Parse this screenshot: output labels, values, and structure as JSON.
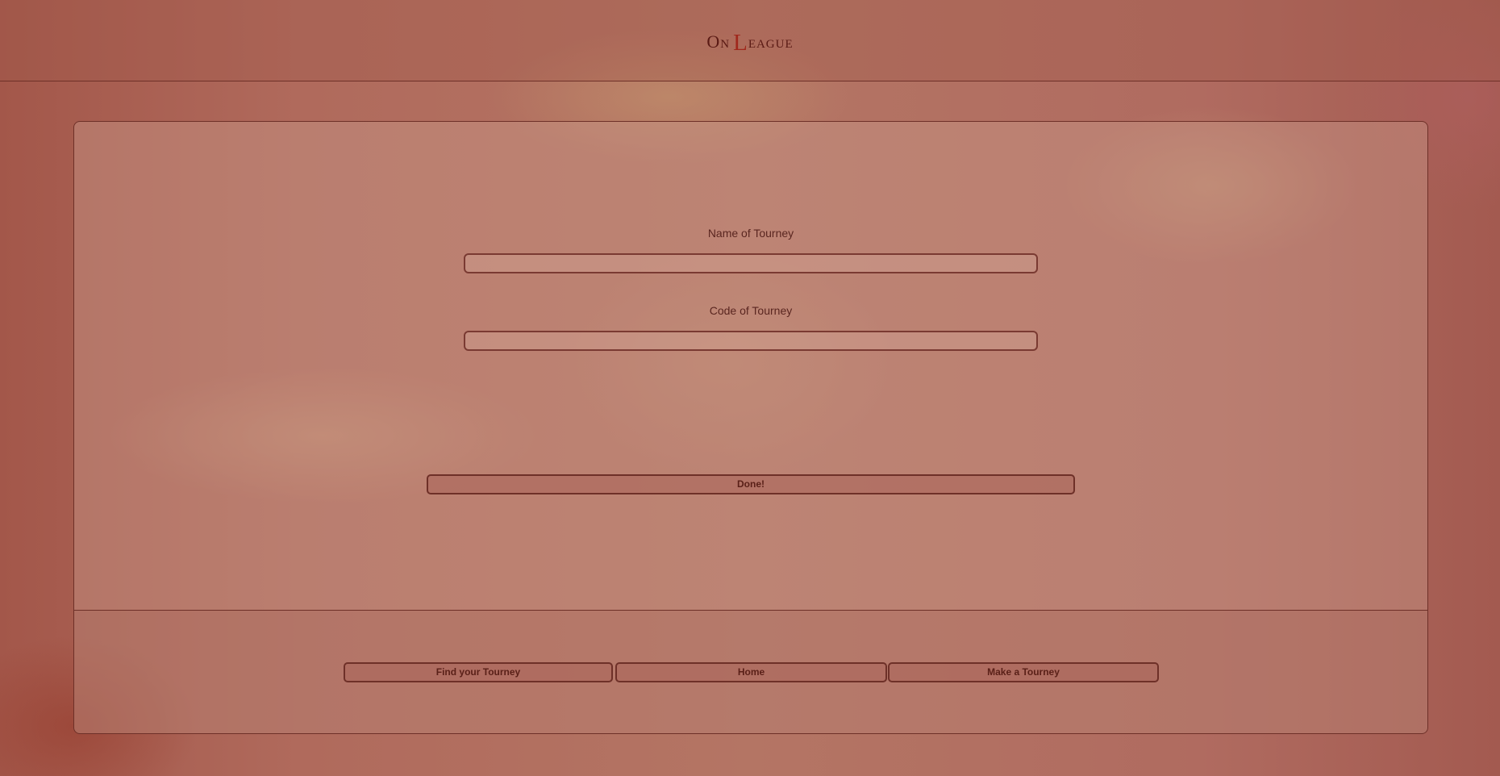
{
  "header": {
    "logo_on": "On",
    "logo_l": "L",
    "logo_rest": "eague"
  },
  "form": {
    "name_label": "Name of Tourney",
    "name_value": "",
    "code_label": "Code of Tourney",
    "code_value": "",
    "done_label": "Done!"
  },
  "footer_nav": {
    "find_label": "Find your Tourney",
    "home_label": "Home",
    "make_label": "Make a Tourney"
  },
  "colors": {
    "accent": "#a0281c",
    "text": "#5a2620",
    "border": "#6e3028"
  }
}
